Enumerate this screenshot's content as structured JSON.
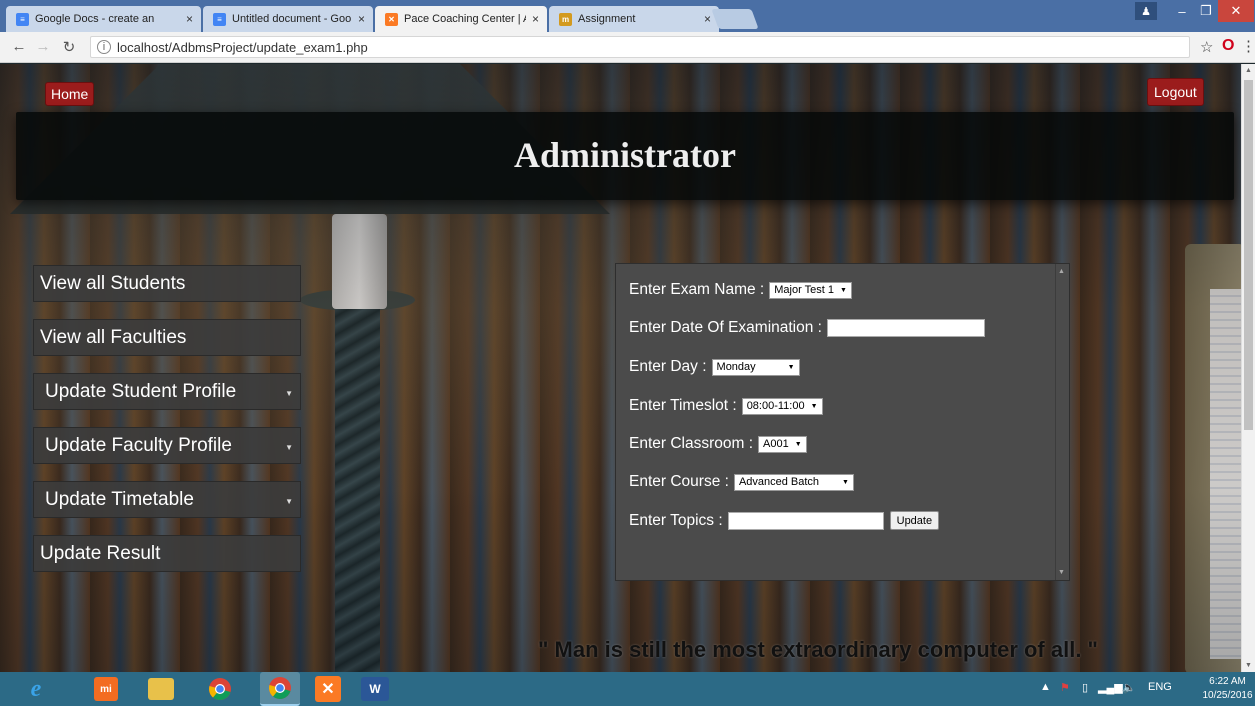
{
  "browser": {
    "tabs": [
      {
        "label": "Google Docs - create an",
        "icon": "docs-icon",
        "color": "#4285f4"
      },
      {
        "label": "Untitled document - Goo",
        "icon": "docs-icon",
        "color": "#4285f4"
      },
      {
        "label": "Pace Coaching Center | A",
        "icon": "xampp-icon",
        "color": "#fb7a24"
      },
      {
        "label": "Assignment",
        "icon": "assignment-icon",
        "color": "#d39a1f"
      }
    ],
    "address": "localhost/AdbmsProject/update_exam1.php"
  },
  "page": {
    "home_label": "Home",
    "logout_label": "Logout",
    "title": "Administrator",
    "menu": [
      {
        "label": "View all Students"
      },
      {
        "label": "View all Faculties"
      },
      {
        "label": "Update Student Profile"
      },
      {
        "label": "Update Faculty Profile"
      },
      {
        "label": "Update Timetable"
      },
      {
        "label": "Update Result"
      }
    ],
    "form": {
      "exam_name_label": "Enter Exam Name :",
      "exam_name_value": "Major Test 1",
      "date_label": "Enter Date Of Examination :",
      "day_label": "Enter Day :",
      "day_value": "Monday",
      "timeslot_label": "Enter Timeslot :",
      "timeslot_value": "08:00-11:00",
      "classroom_label": "Enter Classroom :",
      "classroom_value": "A001",
      "course_label": "Enter Course :",
      "course_value": "Advanced Batch",
      "topics_label": "Enter Topics :",
      "update_label": "Update"
    },
    "quote": "\" Man is still the most extraordinary computer of all. \""
  },
  "taskbar": {
    "language": "ENG",
    "time": "6:22 AM",
    "date": "10/25/2016"
  },
  "colors": {
    "accent_red": "#9b1c1c",
    "taskbar": "#2c6a86",
    "panel": "#4b4b4b"
  }
}
